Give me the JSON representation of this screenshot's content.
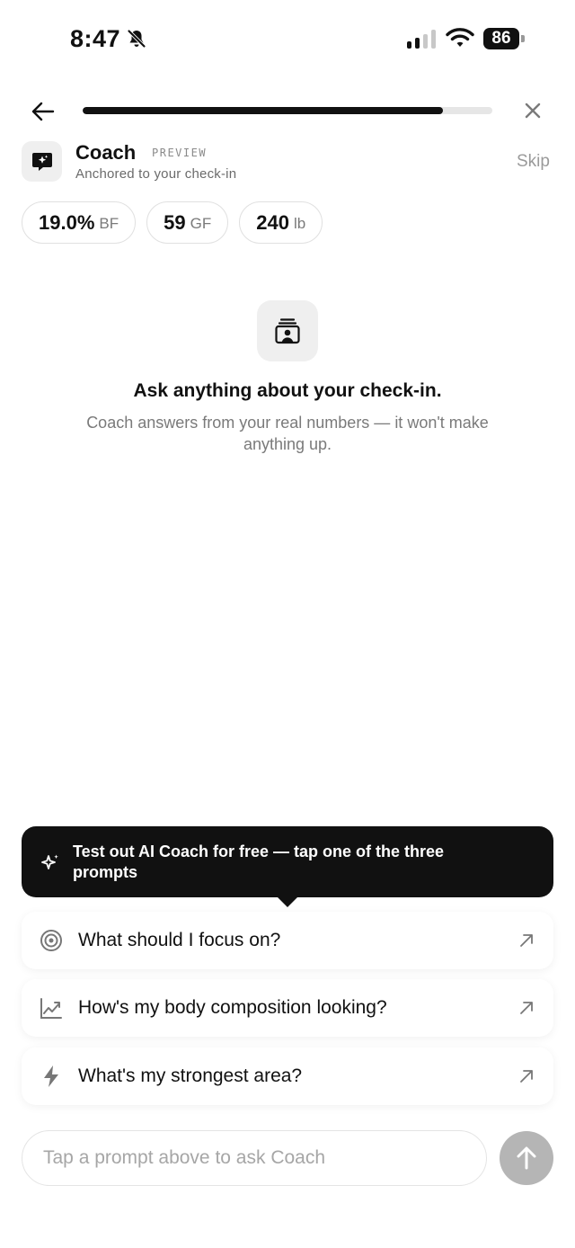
{
  "status_bar": {
    "time": "8:47",
    "battery": "86"
  },
  "nav": {
    "progress": 0.88
  },
  "coach": {
    "name": "Coach",
    "badge": "PREVIEW",
    "subtitle": "Anchored to your check-in",
    "skip_label": "Skip"
  },
  "stats": [
    {
      "value": "19.0%",
      "unit": "BF"
    },
    {
      "value": "59",
      "unit": "GF"
    },
    {
      "value": "240",
      "unit": "lb"
    }
  ],
  "empty_state": {
    "title": "Ask anything about your check-in.",
    "subtitle": "Coach answers from your real numbers — it won't make anything up."
  },
  "tooltip": {
    "text": "Test out AI Coach for free — tap one of the three prompts"
  },
  "prompts": [
    {
      "label": "What should I focus on?",
      "icon": "target-icon"
    },
    {
      "label": "How's my body composition looking?",
      "icon": "trend-chart-icon"
    },
    {
      "label": "What's my strongest area?",
      "icon": "lightning-icon"
    }
  ],
  "composer": {
    "placeholder": "Tap a prompt above to ask Coach"
  },
  "colors": {
    "primary": "#111111",
    "muted": "#7a7a7a",
    "surface": "#efefef",
    "send_disabled": "#b5b5b5"
  }
}
